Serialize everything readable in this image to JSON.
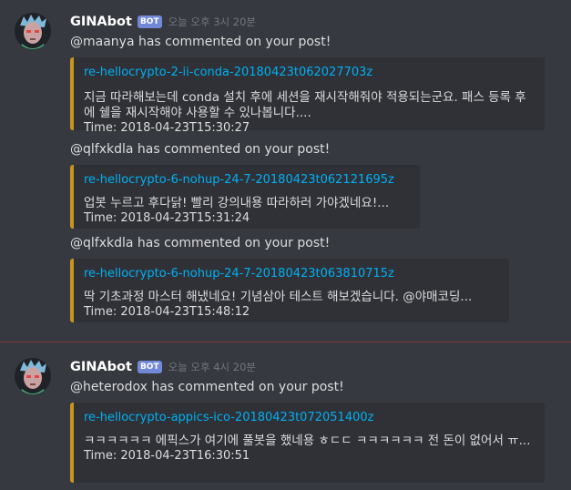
{
  "colors": {
    "background": "#36393f",
    "embed_background": "#2f3136",
    "embed_border": "#c8941d",
    "link": "#00b0f4",
    "bot_tag": "#7289da",
    "divider": "#7a3a3a"
  },
  "groups": [
    {
      "author": "GINAbot",
      "tag": "BOT",
      "timestamp": "오늘 오후 3시 20분",
      "messages": [
        {
          "text": "@maanya has commented on your post!",
          "embed": {
            "link": "re-hellocrypto-2-ii-conda-20180423t062027703z",
            "body": "지금 따라해보는데 conda 설치 후에 세션을 재시작해줘야 적용되는군요. 패스 등록 후에 쉘을 재시작해야 사용할 수 있나봅니다....",
            "time": "Time: 2018-04-23T15:30:27"
          }
        },
        {
          "text": "@qlfxkdla has commented on your post!",
          "embed": {
            "link": "re-hellocrypto-6-nohup-24-7-20180423t062121695z",
            "body": "업봇 누르고 후다닭! 빨리 강의내용 따라하러 가야겠네요!...",
            "time": "Time: 2018-04-23T15:31:24"
          }
        },
        {
          "text": "@qlfxkdla has commented on your post!",
          "embed": {
            "link": "re-hellocrypto-6-nohup-24-7-20180423t063810715z",
            "body": "딱 기초과정 마스터 해냈네요! 기념삼아 테스트 해보겠습니다. @야매코딩...",
            "time": "Time: 2018-04-23T15:48:12"
          }
        }
      ]
    },
    {
      "author": "GINAbot",
      "tag": "BOT",
      "timestamp": "오늘 오후 4시 20분",
      "messages": [
        {
          "text": "@heterodox has commented on your post!",
          "embed": {
            "link": "re-hellocrypto-appics-ico-20180423t072051400z",
            "body": "ㅋㅋㅋㅋㅋㅋ 에픽스가 여기에 풀봇을 했네용 ㅎㄷㄷ ㅋㅋㅋㅋㅋㅋ 전 돈이 없어서 ㅠ...",
            "time": "Time: 2018-04-23T16:30:51"
          }
        }
      ]
    }
  ]
}
